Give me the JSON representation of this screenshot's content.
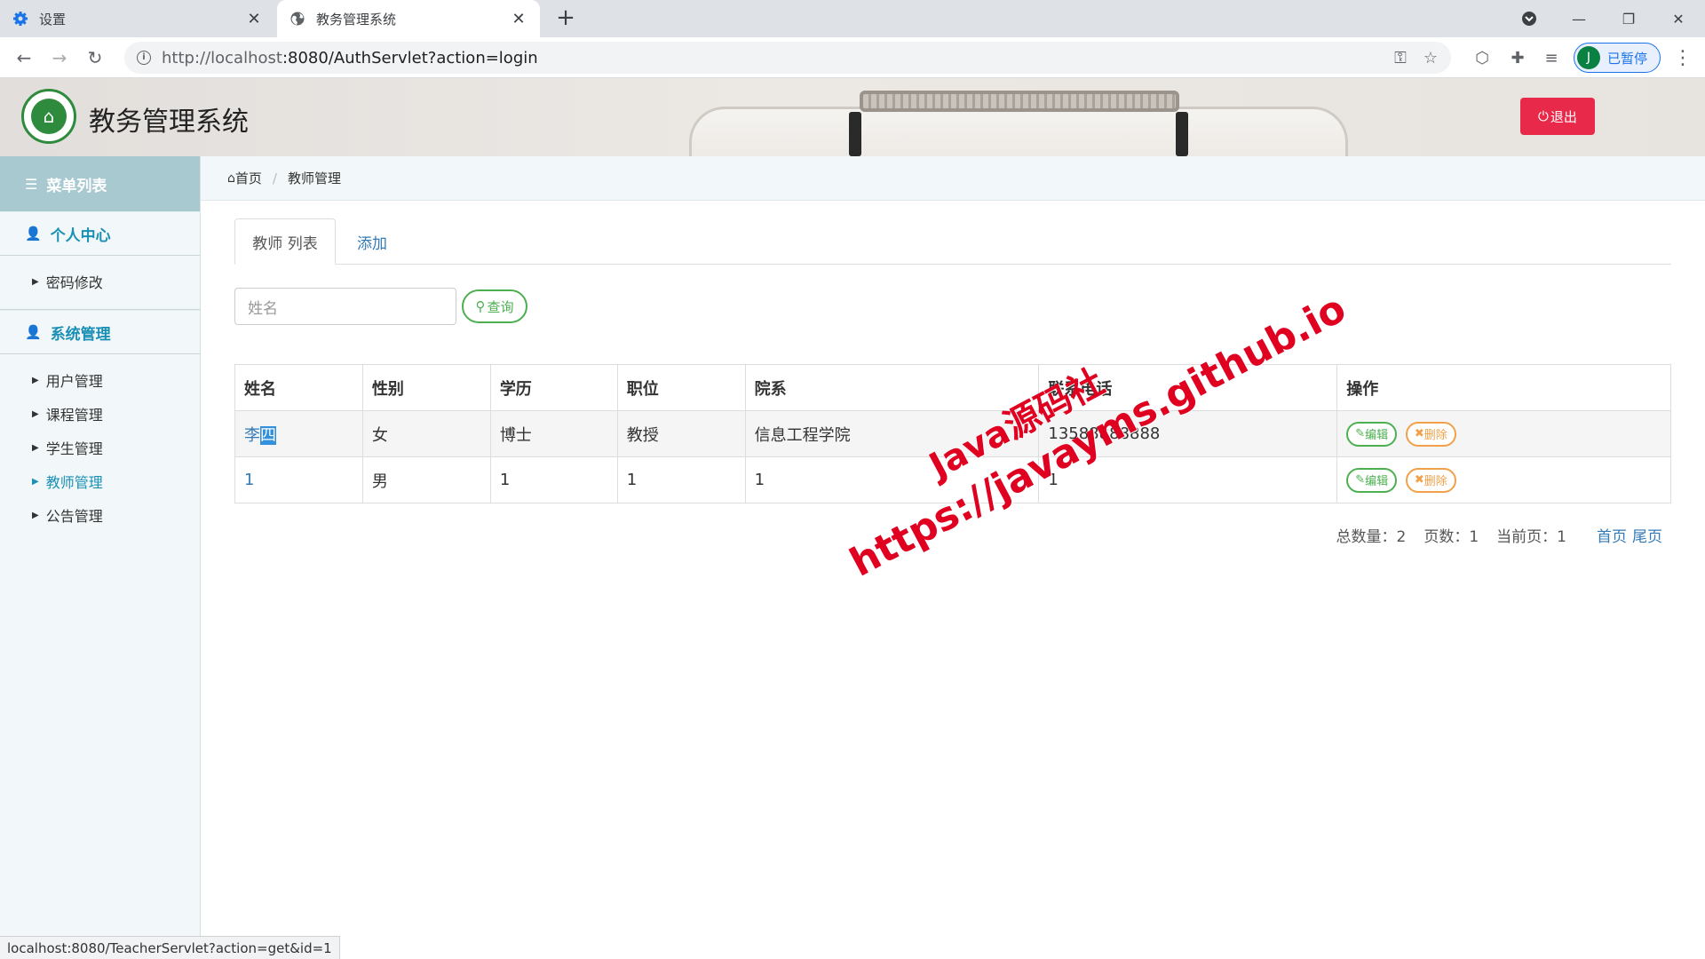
{
  "browser": {
    "tabs": [
      {
        "title": "设置",
        "icon": "gear-icon"
      },
      {
        "title": "教务管理系统",
        "icon": "globe-icon"
      }
    ],
    "url_host": "http://localhost",
    "url_rest": ":8080/AuthServlet?action=login",
    "profile_initial": "J",
    "profile_label": "已暂停",
    "status_url": "localhost:8080/TeacherServlet?action=get&id=1"
  },
  "header": {
    "title": "教务管理系统",
    "logout_label": "退出"
  },
  "sidebar": {
    "menu_title": "菜单列表",
    "groups": [
      {
        "label": "个人中心",
        "items": [
          {
            "label": "密码修改"
          }
        ]
      },
      {
        "label": "系统管理",
        "items": [
          {
            "label": "用户管理"
          },
          {
            "label": "课程管理"
          },
          {
            "label": "学生管理"
          },
          {
            "label": "教师管理"
          },
          {
            "label": "公告管理"
          }
        ]
      }
    ]
  },
  "breadcrumb": {
    "home": "首页",
    "current": "教师管理"
  },
  "tabs": {
    "list": "教师 列表",
    "add": "添加"
  },
  "search": {
    "placeholder": "姓名",
    "button": "查询"
  },
  "table": {
    "headers": [
      "姓名",
      "性别",
      "学历",
      "职位",
      "院系",
      "联系电话",
      "操作"
    ],
    "rows": [
      {
        "name_a": "李",
        "name_b": "四",
        "gender": "女",
        "degree": "博士",
        "position": "教授",
        "dept": "信息工程学院",
        "phone": "13588888888"
      },
      {
        "name_a": "1",
        "name_b": "",
        "gender": "男",
        "degree": "1",
        "position": "1",
        "dept": "1",
        "phone": "1"
      }
    ],
    "edit_label": "编辑",
    "delete_label": "删除"
  },
  "pager": {
    "total": "总数量：2",
    "pages": "页数：1",
    "current": "当前页：1",
    "first": "首页",
    "last": "尾页"
  },
  "watermark": {
    "line1": "Java源码社",
    "line2": "https://javayms.github.io"
  }
}
